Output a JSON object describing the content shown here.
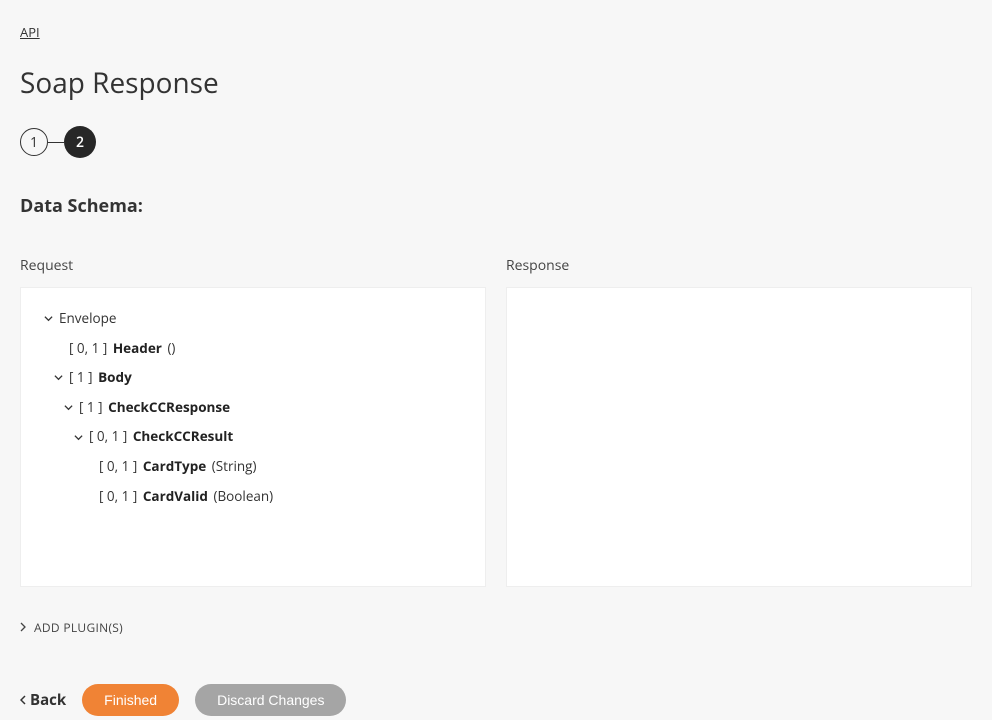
{
  "breadcrumb": {
    "label": "API"
  },
  "page": {
    "title": "Soap Response",
    "section_title": "Data Schema:"
  },
  "stepper": {
    "step1": "1",
    "step2": "2"
  },
  "columns": {
    "request_label": "Request",
    "response_label": "Response"
  },
  "tree": {
    "env": {
      "label": "Envelope"
    },
    "header": {
      "cardinality": "[ 0, 1 ]",
      "name": "Header",
      "type": "()"
    },
    "body": {
      "cardinality": "[ 1 ]",
      "name": "Body"
    },
    "checkcc_response": {
      "cardinality": "[ 1 ]",
      "name": "CheckCCResponse"
    },
    "checkcc_result": {
      "cardinality": "[ 0, 1 ]",
      "name": "CheckCCResult"
    },
    "card_type": {
      "cardinality": "[ 0, 1 ]",
      "name": "CardType",
      "type": "(String)"
    },
    "card_valid": {
      "cardinality": "[ 0, 1 ]",
      "name": "CardValid",
      "type": "(Boolean)"
    }
  },
  "add_plugins": {
    "label": "ADD PLUGIN(S)"
  },
  "buttons": {
    "back": "Back",
    "finished": "Finished",
    "discard": "Discard Changes"
  }
}
